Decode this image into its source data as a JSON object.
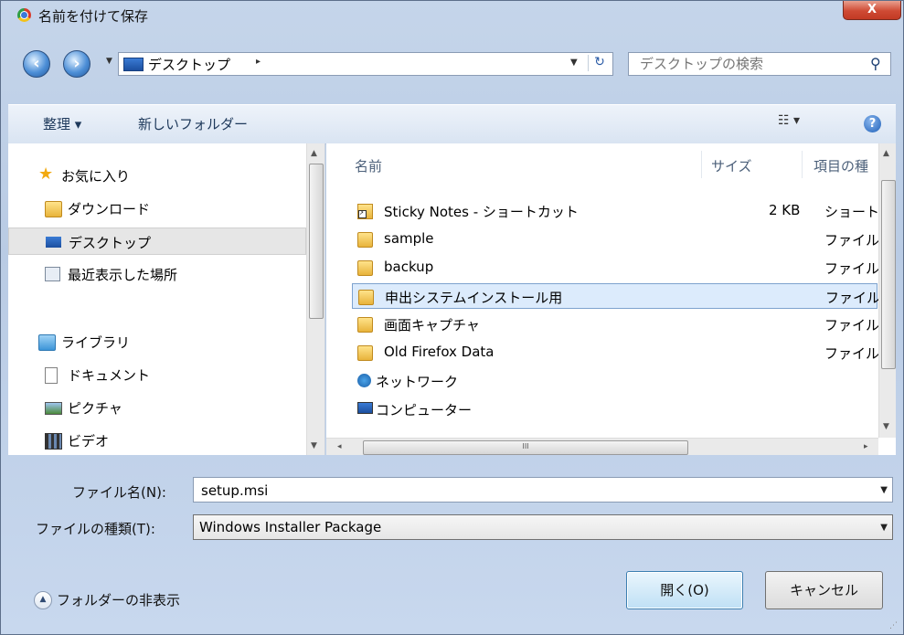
{
  "window": {
    "title": "名前を付けて保存",
    "close_label": "X"
  },
  "address": {
    "path": "デスクトップ",
    "separator": "▸"
  },
  "search": {
    "placeholder": "デスクトップの検索"
  },
  "toolbar": {
    "organize": "整理 ▾",
    "new_folder": "新しいフォルダー",
    "view": "☷ ▾",
    "help": "?"
  },
  "sidebar": {
    "favorites": "お気に入り",
    "items": [
      {
        "label": "ダウンロード",
        "icon": "download-folder-icon"
      },
      {
        "label": "デスクトップ",
        "icon": "desktop-icon"
      },
      {
        "label": "最近表示した場所",
        "icon": "recent-places-icon"
      }
    ],
    "libraries": "ライブラリ",
    "library_items": [
      {
        "label": "ドキュメント",
        "icon": "documents-icon"
      },
      {
        "label": "ピクチャ",
        "icon": "pictures-icon"
      },
      {
        "label": "ビデオ",
        "icon": "videos-icon"
      }
    ]
  },
  "columns": {
    "name": "名前",
    "size": "サイズ",
    "type": "項目の種"
  },
  "files": [
    {
      "name": "Sticky Notes - ショートカット",
      "size": "2 KB",
      "type": "ショート",
      "icon": "shortcut-icon"
    },
    {
      "name": "sample",
      "size": "",
      "type": "ファイル",
      "icon": "folder-icon"
    },
    {
      "name": "backup",
      "size": "",
      "type": "ファイル",
      "icon": "folder-icon"
    },
    {
      "name": "申出システムインストール用",
      "size": "",
      "type": "ファイル",
      "icon": "folder-icon"
    },
    {
      "name": "画面キャプチャ",
      "size": "",
      "type": "ファイル",
      "icon": "folder-icon"
    },
    {
      "name": "Old Firefox Data",
      "size": "",
      "type": "ファイル",
      "icon": "folder-icon"
    },
    {
      "name": "ネットワーク",
      "size": "",
      "type": "",
      "icon": "network-icon"
    },
    {
      "name": "コンピューター",
      "size": "",
      "type": "",
      "icon": "computer-icon"
    }
  ],
  "filename": {
    "label": "ファイル名(N):",
    "value": "setup.msi"
  },
  "filetype": {
    "label": "ファイルの種類(T):",
    "value": "Windows Installer Package"
  },
  "footer": {
    "hide_folders": "フォルダーの非表示",
    "open": "開く(O)",
    "cancel": "キャンセル"
  },
  "colors": {
    "frame": "#b9cbe4",
    "selected_row": "#dcebfc",
    "close_button": "#cf4a34"
  }
}
